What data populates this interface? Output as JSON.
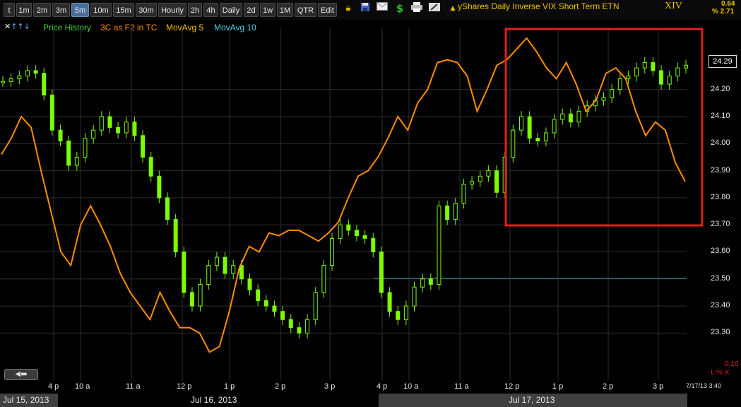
{
  "toolbar": {
    "intervals": [
      "t",
      "1m",
      "2m",
      "3m",
      "5m",
      "10m",
      "15m",
      "30m",
      "Hourly",
      "2h",
      "4h",
      "Daily",
      "2d",
      "1w",
      "1M",
      "QTR",
      "Edit"
    ],
    "active_interval": "5m",
    "icons": [
      "lock-icon",
      "save-icon",
      "email-icon",
      "dollar-icon",
      "print-icon",
      "pencil-icon"
    ]
  },
  "header": {
    "title": "yShares Daily Inverse VIX Short Term ETN",
    "symbol": "XIV",
    "change": "0.64",
    "change_pct": "% 2.71"
  },
  "legend": {
    "price_history": "Price History",
    "three_c": "3C as F2 in TC",
    "ma5": "MovAvg 5",
    "ma10": "MovAvg 10"
  },
  "colors": {
    "candle": "#7cfc00",
    "threec": "#ff8c00",
    "box": "#e02020",
    "ref_line": "#2f6f6f",
    "grid": "#2e2e2e"
  },
  "price_axis": {
    "labels": [
      "24.20",
      "24.10",
      "24.00",
      "23.90",
      "23.80",
      "23.70",
      "23.60",
      "23.50",
      "23.40",
      "23.30"
    ],
    "last": "24.29"
  },
  "time_axis": [
    "4 p",
    "10 a",
    "11 a",
    "12 p",
    "1 p",
    "2 p",
    "3 p",
    "4 p",
    "10 a",
    "11 a",
    "12 p",
    "1 p",
    "2 p",
    "3 p"
  ],
  "dates": [
    "Jul 15, 2013",
    "Jul 16, 2013",
    "Jul 17, 2013"
  ],
  "corner": {
    "timestamp": "7/17/13 3:40",
    "indicator_value": "0.10",
    "indicator_label": "L % X"
  },
  "chart_data": {
    "type": "line",
    "ylim": [
      23.22,
      24.39
    ],
    "series": [
      {
        "name": "Price History",
        "values": [
          24.23,
          24.24,
          24.25,
          24.27,
          24.26,
          24.18,
          24.05,
          24.01,
          23.92,
          23.95,
          24.02,
          24.05,
          24.1,
          24.06,
          24.04,
          24.08,
          24.03,
          23.95,
          23.88,
          23.8,
          23.72,
          23.6,
          23.45,
          23.4,
          23.48,
          23.55,
          23.58,
          23.52,
          23.55,
          23.5,
          23.46,
          23.42,
          23.4,
          23.38,
          23.35,
          23.32,
          23.3,
          23.35,
          23.45,
          23.55,
          23.65,
          23.7,
          23.68,
          23.66,
          23.65,
          23.6,
          23.45,
          23.38,
          23.35,
          23.4,
          23.47,
          23.5,
          23.48,
          23.77,
          23.72,
          23.78,
          23.85,
          23.86,
          23.88,
          23.9,
          23.82,
          23.95,
          24.05,
          24.1,
          24.02,
          24.01,
          24.04,
          24.09,
          24.11,
          24.08,
          24.12,
          24.14,
          24.16,
          24.17,
          24.2,
          24.24,
          24.25,
          24.28,
          24.3,
          24.27,
          24.22,
          24.25,
          24.28,
          24.29
        ]
      },
      {
        "name": "3C as F2 in TC",
        "values": [
          23.96,
          24.02,
          24.1,
          24.06,
          23.9,
          23.75,
          23.6,
          23.55,
          23.7,
          23.77,
          23.7,
          23.62,
          23.52,
          23.45,
          23.4,
          23.35,
          23.45,
          23.38,
          23.32,
          23.32,
          23.3,
          23.23,
          23.25,
          23.38,
          23.54,
          23.62,
          23.6,
          23.67,
          23.66,
          23.68,
          23.68,
          23.66,
          23.64,
          23.67,
          23.71,
          23.8,
          23.88,
          23.9,
          23.95,
          24.02,
          24.1,
          24.05,
          24.15,
          24.2,
          24.3,
          24.31,
          24.3,
          24.25,
          24.12,
          24.2,
          24.29,
          24.31,
          24.35,
          24.39,
          24.34,
          24.28,
          24.24,
          24.3,
          24.22,
          24.12,
          24.16,
          24.26,
          24.28,
          24.24,
          24.12,
          24.03,
          24.08,
          24.05,
          23.93,
          23.86
        ]
      }
    ]
  }
}
